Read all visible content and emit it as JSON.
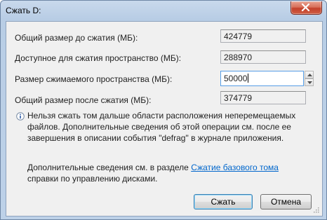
{
  "window": {
    "title": "Сжать D:"
  },
  "fields": {
    "total_before": {
      "label": "Общий размер до сжатия (МБ):",
      "value": "424779"
    },
    "available": {
      "label": "Доступное для сжатия пространство (МБ):",
      "value": "288970"
    },
    "shrink_amount": {
      "label": "Размер сжимаемого пространства (МБ):",
      "value": "50000"
    },
    "total_after": {
      "label": "Общий размер после сжатия (МБ):",
      "value": "374779"
    }
  },
  "info": {
    "text": "Нельзя сжать том дальше области расположения неперемещаемых файлов. Дополнительные сведения об этой операции см. после ее завершения в описании события \"defrag\" в журнале приложения."
  },
  "more_info": {
    "prefix": "Дополнительные сведения см. в разделе ",
    "link": "Сжатие базового тома",
    "suffix": " справки по управлению дисками."
  },
  "buttons": {
    "ok": "Сжать",
    "cancel": "Отмена"
  },
  "colors": {
    "link": "#0066cc",
    "close_button": "#c3402a",
    "focus_border": "#569de5"
  }
}
